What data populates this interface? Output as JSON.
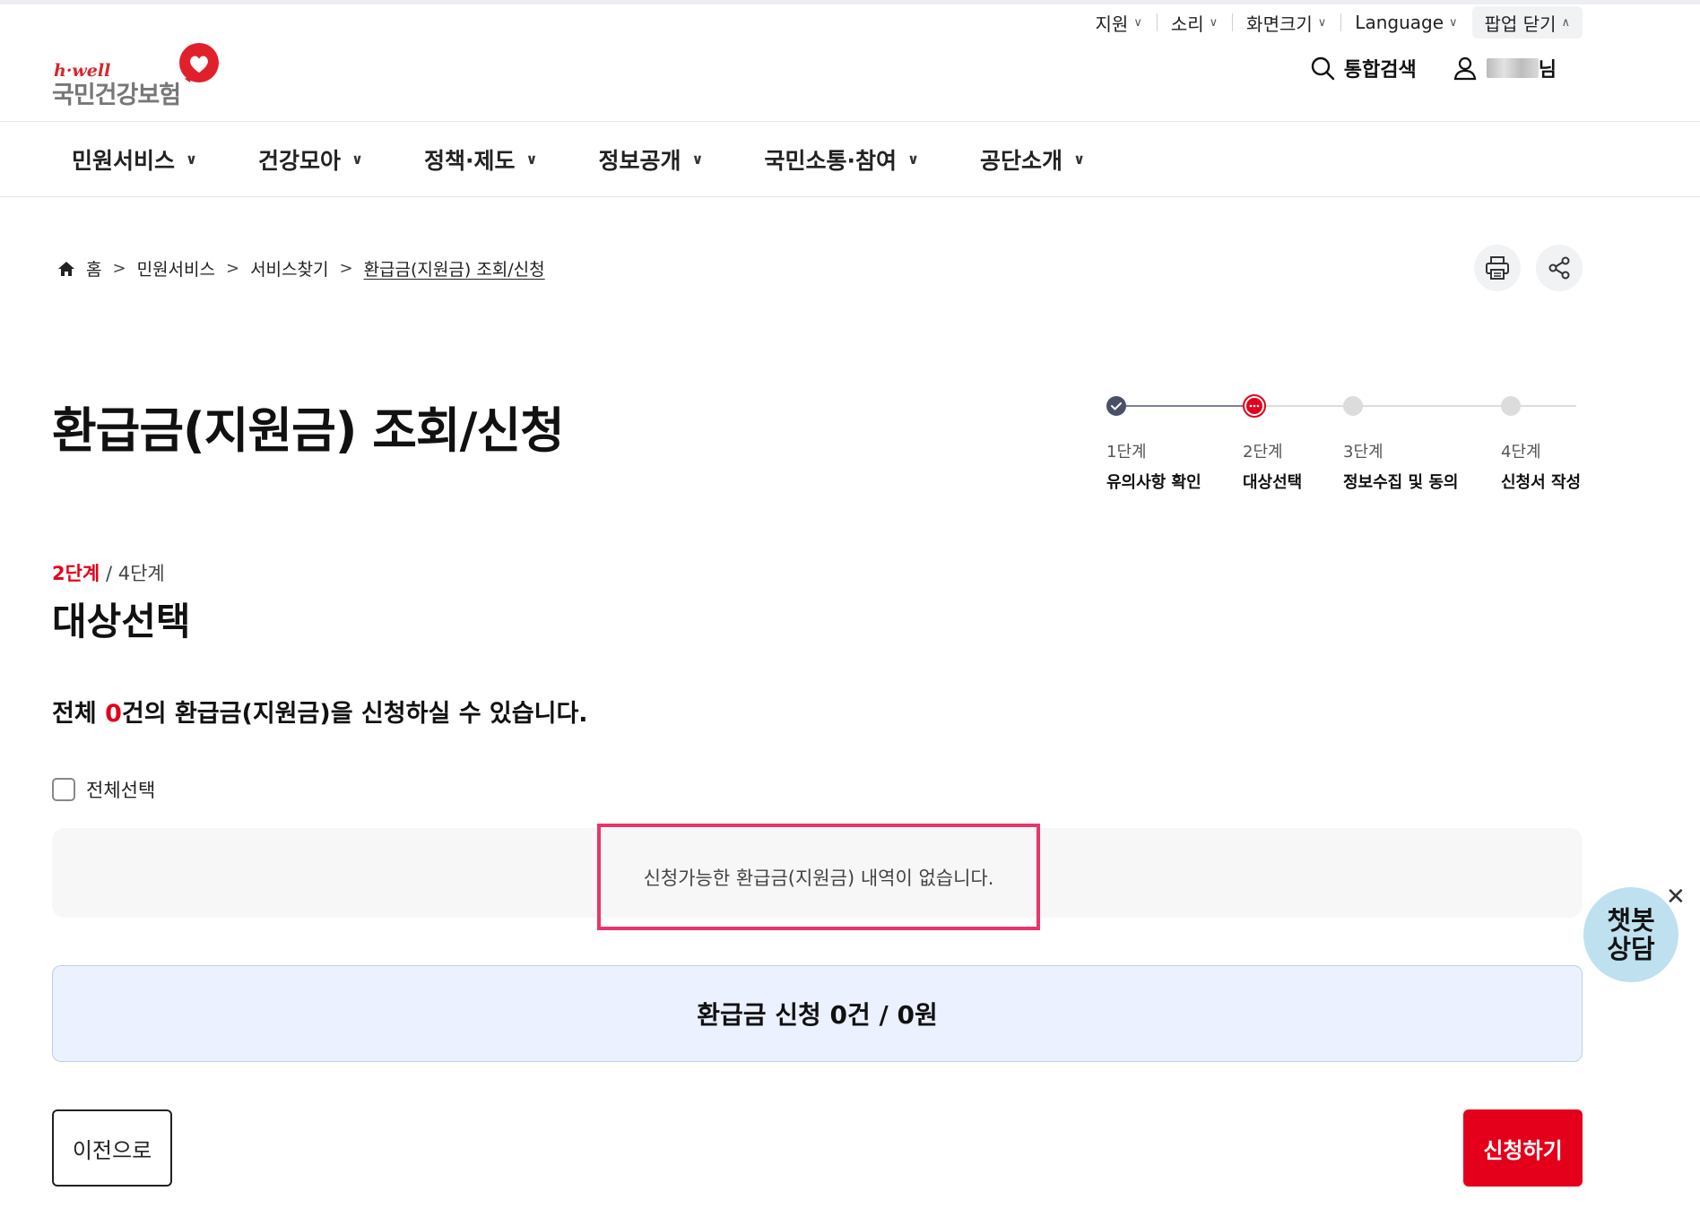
{
  "utility": {
    "items": [
      {
        "label": "지원"
      },
      {
        "label": "소리"
      },
      {
        "label": "화면크기"
      },
      {
        "label": "Language"
      }
    ],
    "popup_close": "팝업 닫기"
  },
  "logo": {
    "tagline": "h·well",
    "name": "국민건강보험"
  },
  "header": {
    "search_label": "통합검색",
    "user_suffix": "님"
  },
  "gnb": {
    "items": [
      {
        "label": "민원서비스"
      },
      {
        "label": "건강모아"
      },
      {
        "label": "정책·제도"
      },
      {
        "label": "정보공개"
      },
      {
        "label": "국민소통·참여"
      },
      {
        "label": "공단소개"
      }
    ]
  },
  "breadcrumb": {
    "home": "홈",
    "items": [
      "민원서비스",
      "서비스찾기",
      "환급금(지원금) 조회/신청"
    ]
  },
  "page": {
    "title": "환급금(지원금) 조회/신청"
  },
  "stepper": {
    "steps": [
      {
        "num": "1단계",
        "label": "유의사항 확인",
        "state": "done"
      },
      {
        "num": "2단계",
        "label": "대상선택",
        "state": "current"
      },
      {
        "num": "3단계",
        "label": "정보수집 및 동의",
        "state": "pending"
      },
      {
        "num": "4단계",
        "label": "신청서 작성",
        "state": "pending"
      }
    ]
  },
  "step_indicator": {
    "current": "2단계",
    "total": "/ 4단계"
  },
  "section": {
    "title": "대상선택"
  },
  "summary": {
    "prefix": "전체 ",
    "count": "0",
    "suffix": "건의 환급금(지원금)을 신청하실 수 있습니다."
  },
  "select_all_label": "전체선택",
  "empty_message": "신청가능한 환급금(지원금) 내역이 없습니다.",
  "total_bar": "환급금 신청 0건 / 0원",
  "buttons": {
    "prev": "이전으로",
    "apply": "신청하기"
  },
  "chatbot": {
    "label": "챗봇 상담"
  },
  "colors": {
    "accent": "#e4001b",
    "highlight": "#e8356b",
    "done_dot": "#4a4f6a",
    "chatbot_bg": "#bfe0ef",
    "total_bg": "#ebf1ff"
  }
}
